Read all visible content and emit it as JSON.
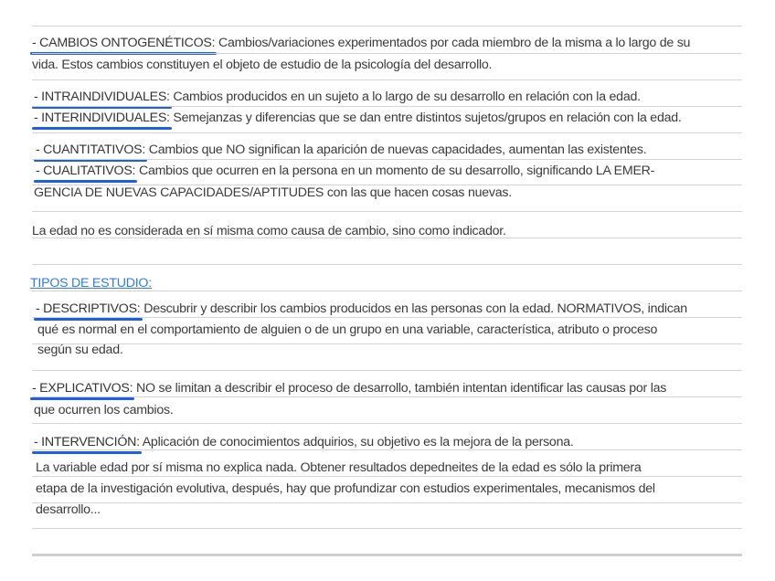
{
  "notes": {
    "ontogeneticos": {
      "label": "- CAMBIOS ONTOGENÉTICOS:",
      "text": " Cambios/variaciones experimentados por cada miembro de la misma a lo largo de su",
      "cont": "vida. Estos cambios constituyen el objeto de estudio de la psicología del desarrollo."
    },
    "intraindividuales": {
      "label": "- INTRAINDIVIDUALES:",
      "text": " Cambios producidos en un sujeto a lo largo de su desarrollo en relación con la edad."
    },
    "interindividuales": {
      "label": "- INTERINDIVIDUALES:",
      "text": " Semejanzas y diferencias que se dan entre distintos sujetos/grupos en relación con la edad."
    },
    "cuantitativos": {
      "label": "- CUANTITATIVOS:",
      "text": " Cambios que NO significan la aparición de nuevas capacidades, aumentan las existentes."
    },
    "cualitativos": {
      "label": "- CUALITATIVOS:",
      "text": " Cambios que ocurren en la persona en un momento de su desarrollo, significando LA EMER-",
      "cont": "GENCIA DE NUEVAS CAPACIDADES/APTITUDES con las que hacen cosas nuevas."
    },
    "edad_note": "La edad no es considerada en sí misma como causa de cambio, sino como indicador.",
    "tipos_heading": "TIPOS DE ESTUDIO:",
    "descriptivos": {
      "label": "- DESCRIPTIVOS:",
      "text": " Descubrir y describir los cambios producidos en las personas con la edad. NORMATIVOS, indican",
      "cont1": "qué es normal en el comportamiento de alguien o de un grupo en una variable, característica, atributo o proceso",
      "cont2": "según su edad."
    },
    "explicativos": {
      "label": "- EXPLICATIVOS:",
      "text": " NO se limitan a describir el proceso de desarrollo, también intentan identificar las causas por las",
      "cont": "que ocurren los cambios."
    },
    "intervencion": {
      "label": "- INTERVENCIÓN:",
      "text": " Aplicación de conocimientos adquirios, su objetivo es la mejora de la persona."
    },
    "variable_note": [
      "La variable edad por sí misma no explica nada. Obtener resultados depedneites de la edad es sólo la primera",
      "etapa de la investigación evolutiva, después, hay que profundizar con estudios experimentales, mecanismos del",
      "desarrollo..."
    ]
  },
  "colors": {
    "accent": "#1f5fe6",
    "heading": "#2f7bf0",
    "text": "#3a3a3a",
    "rule": "#d4d4d4"
  }
}
